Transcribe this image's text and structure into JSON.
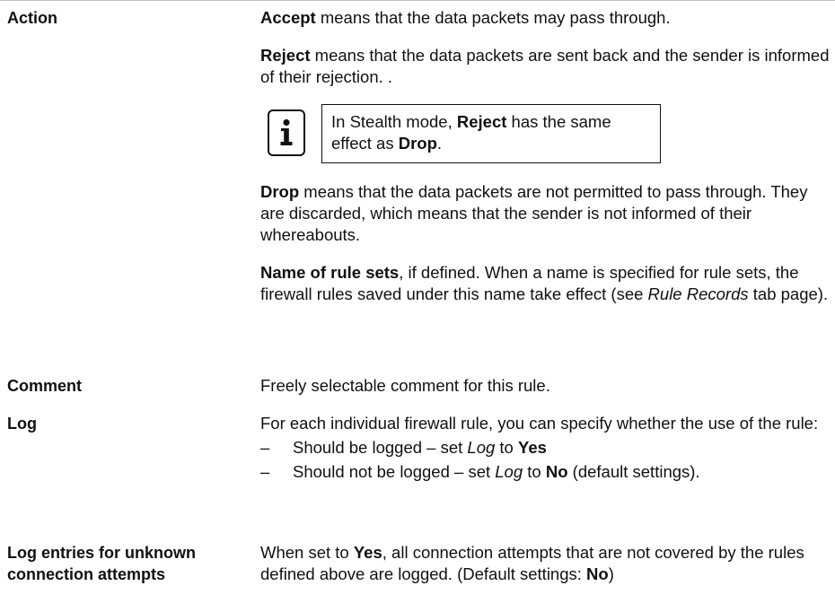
{
  "rows": {
    "action": {
      "label": "Action",
      "accept": {
        "term": "Accept",
        "text": " means that the data packets may pass through."
      },
      "reject": {
        "term": "Reject",
        "text": " means that the data packets are sent back and the sender is informed of their rejection. ."
      },
      "note": {
        "icon": "info-icon",
        "pre": "In Stealth mode, ",
        "term1": "Reject",
        "mid": " has the same effect as ",
        "term2": "Drop",
        "post": "."
      },
      "drop": {
        "term": "Drop",
        "text": " means that the data packets are not permitted to pass through. They are discarded, which means that the sender is not informed of their whereabouts."
      },
      "rulesets": {
        "term": "Name of rule sets",
        "text": ", if defined. When a name is specified for rule sets, the firewall rules saved under this name take effect (see ",
        "italic": "Rule Records",
        "post": " tab page)."
      }
    },
    "comment": {
      "label": "Comment",
      "text": "Freely selectable comment for this rule."
    },
    "log": {
      "label": "Log",
      "intro": "For each individual firewall rule, you can specify whether the use of the rule:",
      "bullets": [
        {
          "dash": "–",
          "pre": "Should be logged – set ",
          "italic": "Log",
          "mid": " to ",
          "bold": "Yes",
          "post": ""
        },
        {
          "dash": "–",
          "pre": "Should not be logged – set ",
          "italic": "Log",
          "mid": " to ",
          "bold": "No",
          "post": " (default settings)."
        }
      ]
    },
    "unknown": {
      "label": "Log entries for unknown connection attempts",
      "pre": "When set to ",
      "bold1": "Yes",
      "mid": ", all connection attempts that are not covered by the rules defined above are logged. (Default settings: ",
      "bold2": "No",
      "post": ")"
    }
  }
}
